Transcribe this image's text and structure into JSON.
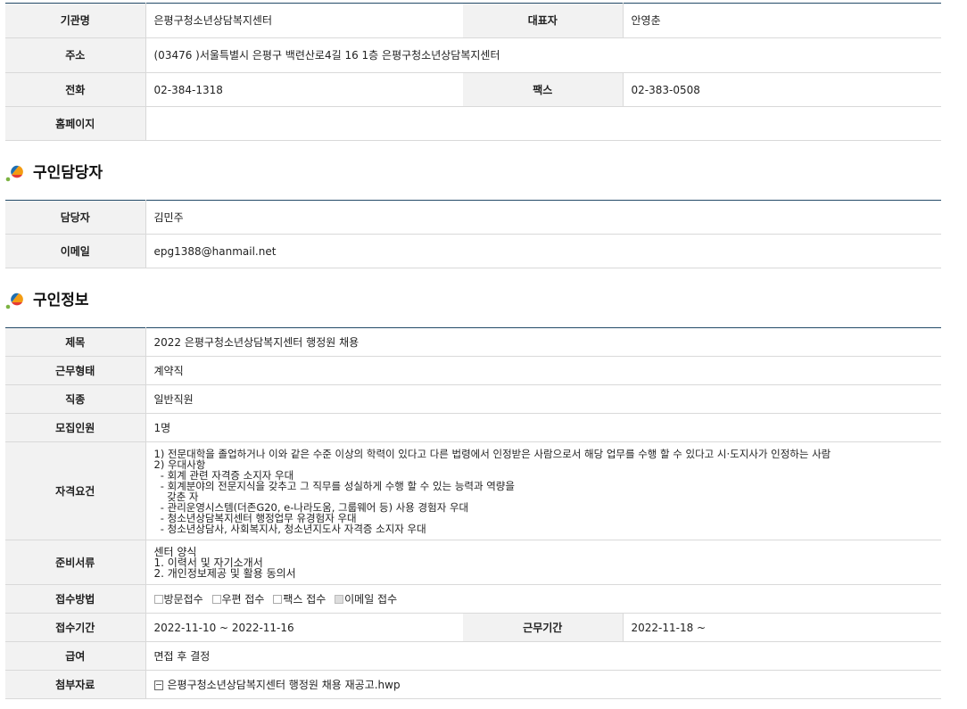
{
  "org": {
    "rows": [
      {
        "label": "기관명",
        "value": "은평구청소년상담복지센터",
        "label2": "대표자",
        "value2": "안영춘"
      },
      {
        "label": "주소",
        "value": "(03476 )서울특별시 은평구 백련산로4길 16 1층 은평구청소년상담복지센터"
      },
      {
        "label": "전화",
        "value": "02-384-1318",
        "label2": "팩스",
        "value2": "02-383-0508"
      },
      {
        "label": "홈페이지",
        "value": ""
      }
    ]
  },
  "contact": {
    "title": "구인담당자",
    "rows": [
      {
        "label": "담당자",
        "value": "김민주"
      },
      {
        "label": "이메일",
        "value": "epg1388@hanmail.net"
      }
    ]
  },
  "job": {
    "title": "구인정보",
    "subject": {
      "label": "제목",
      "value": "2022 은평구청소년상담복지센터 행정원 채용"
    },
    "work_type": {
      "label": "근무형태",
      "value": "계약직"
    },
    "category": {
      "label": "직종",
      "value": "일반직원"
    },
    "headcount": {
      "label": "모집인원",
      "value": "1명"
    },
    "qualifications": {
      "label": "자격요건",
      "lines": [
        "1) 전문대학을 졸업하거나 이와 같은 수준 이상의 학력이 있다고 다른 법령에서 인정받은 사람으로서 해당 업무를 수행 할 수 있다고 시·도지사가 인정하는 사람",
        "2) 우대사항",
        "  - 회계 관련 자격증 소지자 우대",
        "  - 회계분야의 전문지식을 갖추고 그 직무를 성실하게 수행 할 수 있는 능력과 역량을",
        "    갖춘 자",
        "  - 관리운영시스템(더존G20, e-나라도움, 그룹웨어 등) 사용 경험자 우대",
        "  - 청소년상담복지센터 행정업무 유경험자 우대",
        "  - 청소년상담사, 사회복지사, 청소년지도사 자격증 소지자 우대"
      ]
    },
    "documents": {
      "label": "준비서류",
      "lines": [
        "센터 양식",
        "1. 이력서 및 자기소개서",
        "2. 개인정보제공 및 활용 동의서"
      ]
    },
    "method": {
      "label": "접수방법",
      "options": [
        {
          "text": "방문접수",
          "checked": false
        },
        {
          "text": "우편 접수",
          "checked": false
        },
        {
          "text": "팩스 접수",
          "checked": false
        },
        {
          "text": "이메일 접수",
          "checked": true
        }
      ]
    },
    "period": {
      "label": "접수기간",
      "value": "2022-11-10 ~ 2022-11-16",
      "label2": "근무기간",
      "value2": "2022-11-18 ~"
    },
    "salary": {
      "label": "급여",
      "value": "면접 후 결정"
    },
    "attachment": {
      "label": "첨부자료",
      "value": "은평구청소년상담복지센터 행정원 채용 재공고.hwp"
    }
  },
  "colors": {
    "header_line": "#234a68",
    "label_bg": "#f2f2f2",
    "border": "#d9d9d9"
  }
}
